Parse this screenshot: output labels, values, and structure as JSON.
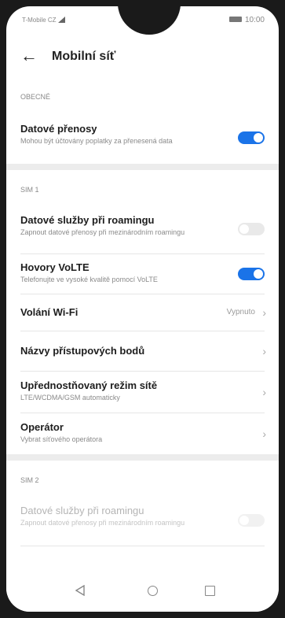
{
  "status_bar": {
    "carrier": "T-Mobile CZ",
    "time": "10:00"
  },
  "app_bar": {
    "title": "Mobilní síť"
  },
  "sections": {
    "general": {
      "header": "OBECNÉ",
      "data_transfer": {
        "title": "Datové přenosy",
        "subtitle": "Mohou být účtovány poplatky za přenesená data"
      }
    },
    "sim1": {
      "header": "SIM 1",
      "roaming": {
        "title": "Datové služby při roamingu",
        "subtitle": "Zapnout datové přenosy při mezinárodním roamingu"
      },
      "volte": {
        "title": "Hovory VoLTE",
        "subtitle": "Telefonujte ve vysoké kvalitě pomocí VoLTE"
      },
      "wifi_calling": {
        "title": "Volání Wi-Fi",
        "value": "Vypnuto"
      },
      "apn": {
        "title": "Názvy přístupových bodů"
      },
      "network_mode": {
        "title": "Upřednostňovaný režim sítě",
        "subtitle": "LTE/WCDMA/GSM automaticky"
      },
      "operator": {
        "title": "Operátor",
        "subtitle": "Vybrat síťového operátora"
      }
    },
    "sim2": {
      "header": "SIM 2",
      "roaming": {
        "title": "Datové služby při roamingu",
        "subtitle": "Zapnout datové přenosy při mezinárodním roamingu"
      }
    }
  },
  "toggles": {
    "data_transfer": "on",
    "sim1_roaming": "off",
    "volte": "on",
    "sim2_roaming": "off"
  },
  "colors": {
    "accent": "#1a73e8",
    "toggle_off": "#e9e9e9"
  }
}
